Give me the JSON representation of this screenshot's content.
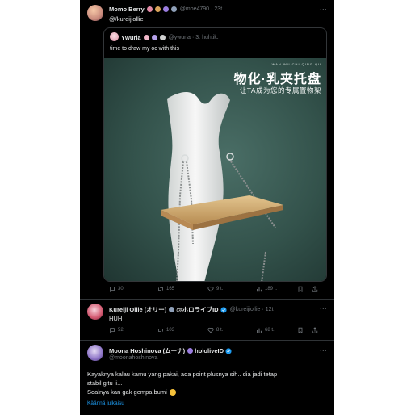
{
  "tweet1": {
    "name": "Momo Berry",
    "handle": "@moe4790",
    "time": "23t",
    "text": "@/kureijiollie"
  },
  "quote": {
    "name": "Ywuria",
    "handle": "@ywuria",
    "time": "3. huhtik.",
    "text": "time to draw my oc with this",
    "image": {
      "top_small": "WAN WU CHI QING QU",
      "title": "物化·乳夹托盘",
      "subtitle": "让TA成为您的专属置物架"
    }
  },
  "tweet1_actions": {
    "replies": "30",
    "retweets": "165",
    "likes": "9 t.",
    "views": "189 t."
  },
  "tweet2": {
    "name": "Kureiji Ollie (オリー)",
    "name_tag": "@ホロライブID",
    "handle": "@kureijiollie",
    "time": "12t",
    "text": "HUH"
  },
  "tweet2_actions": {
    "replies": "52",
    "retweets": "103",
    "likes": "8 t.",
    "views": "68 t."
  },
  "tweet3": {
    "name": "Moona Hoshinova (ムーナ)",
    "name_tag": "hololiveID",
    "handle": "@moonahoshinova",
    "line1": "Kayaknya kalau kamu yang pakai, ada point plusnya sih.. dia jadi tetap",
    "line2": "stabil gitu li...",
    "line3": "Soalnya kan gak gempa bumi",
    "translate": "Käännä julkaisu"
  },
  "more_icon": "...",
  "colors": {
    "bg": "#000000",
    "text": "#e7e9ea",
    "muted": "#71767b",
    "link": "#1d9bf0",
    "verified": "#1d9bf0",
    "image_bg": "#3c5c55"
  }
}
